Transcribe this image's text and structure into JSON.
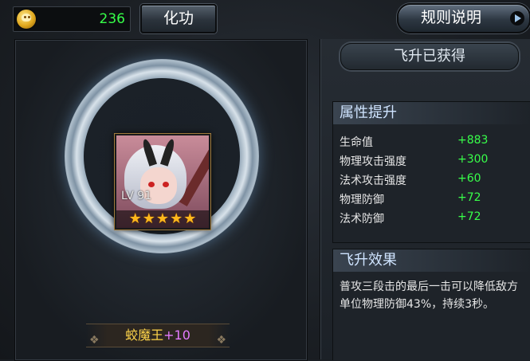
{
  "currency": {
    "icon": "skull-coin-icon",
    "value": "236"
  },
  "buttons": {
    "huagong": "化功",
    "rules": "规则说明"
  },
  "hero": {
    "level": "LV 91",
    "stars": 5,
    "name": "蛟魔王",
    "plus": "+10"
  },
  "banner": "飞升已获得",
  "attributes": {
    "title": "属性提升",
    "items": [
      {
        "label": "生命值",
        "value": "+883"
      },
      {
        "label": "物理攻击强度",
        "value": "+300"
      },
      {
        "label": "法术攻击强度",
        "value": "+60"
      },
      {
        "label": "物理防御",
        "value": "+72"
      },
      {
        "label": "法术防御",
        "value": "+72"
      }
    ]
  },
  "effect": {
    "title": "飞升效果",
    "text": "普攻三段击的最后一击可以降低敌方单位物理防御43%，持续3秒。"
  },
  "colors": {
    "green": "#38ff4a",
    "gold": "#ffd54a",
    "purple": "#e47bff",
    "accent_blue": "#cfe4ff"
  }
}
